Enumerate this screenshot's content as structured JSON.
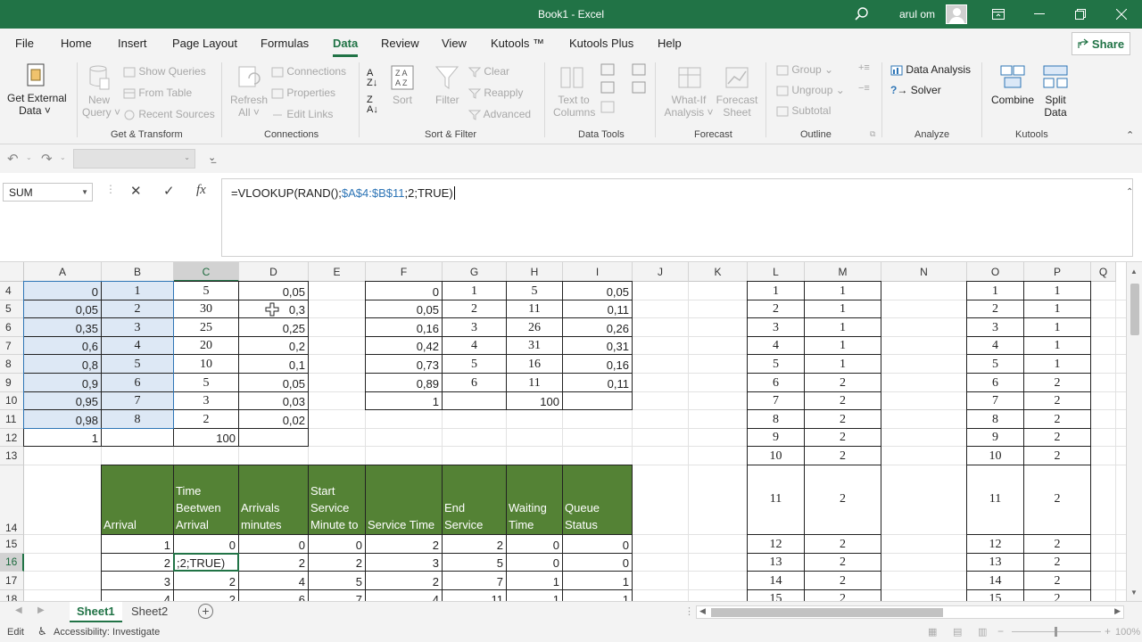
{
  "window": {
    "title": "Book1  -  Excel",
    "user": "arul om"
  },
  "tabs": [
    "File",
    "Home",
    "Insert",
    "Page Layout",
    "Formulas",
    "Data",
    "Review",
    "View",
    "Kutools ™",
    "Kutools Plus",
    "Help"
  ],
  "active_tab": "Data",
  "share_label": "Share",
  "ribbon": {
    "get_external_data": "Get External",
    "get_external_data_2": "Data ˅",
    "new_query": "New",
    "new_query_2": "Query ˅",
    "show_queries": "Show Queries",
    "from_table": "From Table",
    "recent_sources": "Recent Sources",
    "refresh": "Refresh",
    "refresh_2": "All ˅",
    "connections": "Connections",
    "properties": "Properties",
    "edit_links": "Edit Links",
    "sort": "Sort",
    "filter": "Filter",
    "clear": "Clear",
    "reapply": "Reapply",
    "advanced": "Advanced",
    "text_to_columns": "Text to",
    "text_to_columns_2": "Columns",
    "what_if": "What-If",
    "what_if_2": "Analysis ˅",
    "forecast_sheet": "Forecast",
    "forecast_sheet_2": "Sheet",
    "group": "Group",
    "ungroup": "Ungroup",
    "subtotal": "Subtotal",
    "data_analysis": "Data Analysis",
    "solver": "Solver",
    "combine": "Combine",
    "split_data": "Split",
    "split_data_2": "Data",
    "groups": {
      "get_transform": "Get & Transform",
      "connections": "Connections",
      "sort_filter": "Sort & Filter",
      "data_tools": "Data Tools",
      "forecast": "Forecast",
      "outline": "Outline",
      "analyze": "Analyze",
      "kutools": "Kutools"
    }
  },
  "formula_bar": {
    "name_box": "SUM",
    "formula_prefix": "=VLOOKUP(RAND();",
    "formula_ref": "$A$4:$B$11",
    "formula_suffix": ";2;TRUE)"
  },
  "columns": [
    "A",
    "B",
    "C",
    "D",
    "E",
    "F",
    "G",
    "H",
    "I",
    "J",
    "K",
    "L",
    "M",
    "N",
    "O",
    "P",
    "Q"
  ],
  "rows": [
    "4",
    "5",
    "6",
    "7",
    "8",
    "9",
    "10",
    "11",
    "12",
    "13",
    "14",
    "15",
    "16",
    "17",
    "18"
  ],
  "table1": {
    "A": [
      "0",
      "0,05",
      "0,35",
      "0,6",
      "0,8",
      "0,9",
      "0,95",
      "0,98",
      "1"
    ],
    "B": [
      "1",
      "2",
      "3",
      "4",
      "5",
      "6",
      "7",
      "8"
    ],
    "C": [
      "5",
      "30",
      "25",
      "20",
      "10",
      "5",
      "3",
      "2",
      "100"
    ],
    "D": [
      "0,05",
      "0,3",
      "0,25",
      "0,2",
      "0,1",
      "0,05",
      "0,03",
      "0,02"
    ]
  },
  "table2": {
    "F": [
      "0",
      "0,05",
      "0,16",
      "0,42",
      "0,73",
      "0,89",
      "1"
    ],
    "G": [
      "1",
      "2",
      "3",
      "4",
      "5",
      "6"
    ],
    "H": [
      "5",
      "11",
      "26",
      "31",
      "16",
      "11",
      "100"
    ],
    "I": [
      "0,05",
      "0,11",
      "0,26",
      "0,31",
      "0,16",
      "0,11"
    ]
  },
  "table3": {
    "L": [
      "1",
      "2",
      "3",
      "4",
      "5",
      "6",
      "7",
      "8",
      "9",
      "10",
      "11",
      "12",
      "13",
      "14",
      "15"
    ],
    "M": [
      "1",
      "1",
      "1",
      "1",
      "1",
      "2",
      "2",
      "2",
      "2",
      "2",
      "2",
      "2",
      "2",
      "2",
      "2"
    ],
    "O": [
      "1",
      "2",
      "3",
      "4",
      "5",
      "6",
      "7",
      "8",
      "9",
      "10",
      "11",
      "12",
      "13",
      "14",
      "15"
    ],
    "P": [
      "1",
      "1",
      "1",
      "1",
      "1",
      "2",
      "2",
      "2",
      "2",
      "2",
      "2",
      "2",
      "2",
      "2",
      "2"
    ]
  },
  "sim_headers": [
    "Arrival",
    "Time Beetwen Arrival",
    "Arrivals minutes",
    "Start Service Minute to",
    "Service Time",
    "End Service",
    "Waiting Time",
    "Queue Status"
  ],
  "sim_rows": [
    [
      "1",
      "0",
      "0",
      "0",
      "2",
      "2",
      "0",
      "0"
    ],
    [
      "2",
      ";2;TRUE)",
      "2",
      "2",
      "3",
      "5",
      "0",
      "0"
    ],
    [
      "3",
      "2",
      "4",
      "5",
      "2",
      "7",
      "1",
      "1"
    ],
    [
      "4",
      "2",
      "6",
      "7",
      "4",
      "11",
      "1",
      "1"
    ]
  ],
  "sheets": [
    "Sheet1",
    "Sheet2"
  ],
  "status": {
    "mode": "Edit",
    "accessibility": "Accessibility: Investigate",
    "zoom": "100%"
  },
  "colors": {
    "excel_green": "#217346",
    "header_green": "#548235",
    "selection": "#dde8f5"
  }
}
